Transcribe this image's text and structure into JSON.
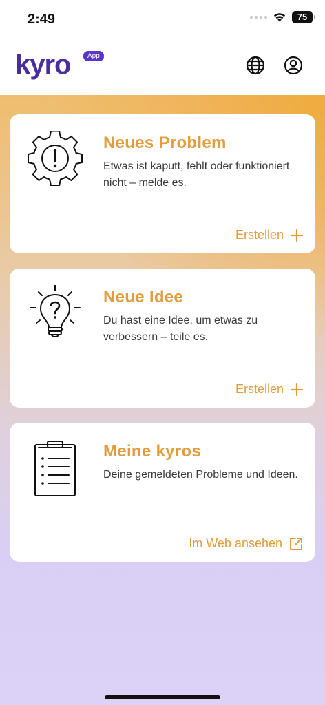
{
  "status_bar": {
    "time": "2:49",
    "battery": "75"
  },
  "header": {
    "logo_text": "kyro",
    "logo_badge": "App",
    "icons": [
      "globe-icon",
      "account-icon"
    ]
  },
  "cards": [
    {
      "icon": "gear-alert-icon",
      "title": "Neues Problem",
      "description": "Etwas ist kaputt, fehlt oder funktioniert nicht – melde es.",
      "action_label": "Erstellen",
      "action_icon": "plus-icon"
    },
    {
      "icon": "lightbulb-question-icon",
      "title": "Neue Idee",
      "description": "Du hast eine Idee, um etwas zu verbessern – teile es.",
      "action_label": "Erstellen",
      "action_icon": "plus-icon"
    },
    {
      "icon": "clipboard-list-icon",
      "title": "Meine kyros",
      "description": "Deine gemeldeten Probleme und Ideen.",
      "action_label": "Im Web ansehen",
      "action_icon": "external-link-icon"
    }
  ],
  "colors": {
    "brand": "#4a2ea0",
    "accent": "#e39c3c"
  }
}
